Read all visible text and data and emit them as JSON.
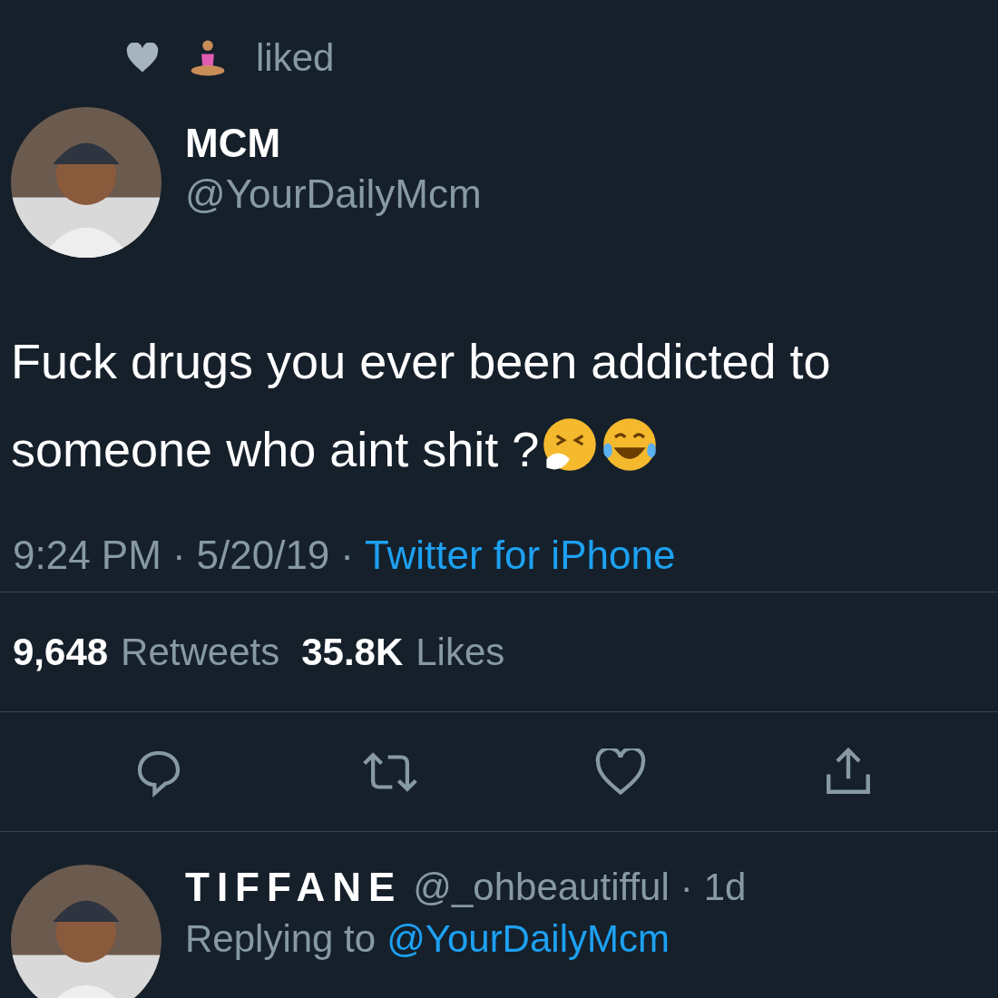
{
  "liked_by": {
    "label": "liked"
  },
  "tweet": {
    "author": {
      "name": "MCM",
      "handle": "@YourDailyMcm"
    },
    "text_lines": [
      "Fuck drugs you ever been addicted to",
      "someone who aint shit ?"
    ],
    "time": "9:24 PM",
    "separator_1": "·",
    "date": "5/20/19",
    "separator_2": "·",
    "source": "Twitter for iPhone"
  },
  "stats": [
    {
      "count": "9,648",
      "label": "Retweets"
    },
    {
      "count": "35.8K",
      "label": "Likes"
    }
  ],
  "reply": {
    "name": "TIFFANE",
    "handle": "@_ohbeautifful",
    "separator": "·",
    "age": "1d",
    "replying_label": "Replying to",
    "replying_to": "@YourDailyMcm"
  }
}
